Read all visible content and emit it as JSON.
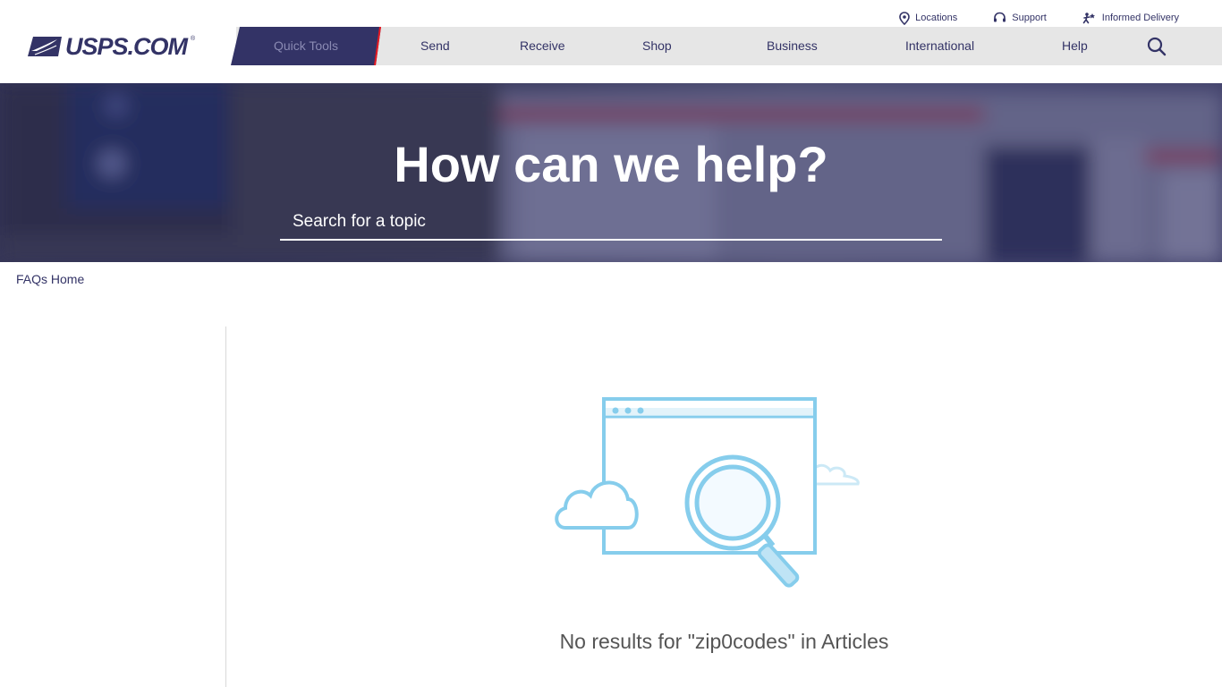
{
  "utility": {
    "locations": "Locations",
    "support": "Support",
    "informed_delivery": "Informed Delivery"
  },
  "logo": {
    "text": "USPS.COM",
    "reg": "®"
  },
  "nav": {
    "quick_tools": "Quick Tools",
    "send": "Send",
    "receive": "Receive",
    "shop": "Shop",
    "business": "Business",
    "international": "International",
    "help": "Help"
  },
  "hero": {
    "title": "How can we help?",
    "search_placeholder": "Search for a topic"
  },
  "breadcrumb": {
    "home": "FAQs Home"
  },
  "results": {
    "message": "No results for \"zip0codes\" in Articles"
  },
  "colors": {
    "brand_navy": "#333366",
    "brand_red": "#e71921",
    "nav_bg": "#e6e6e6",
    "illustration_blue": "#86cdec"
  }
}
